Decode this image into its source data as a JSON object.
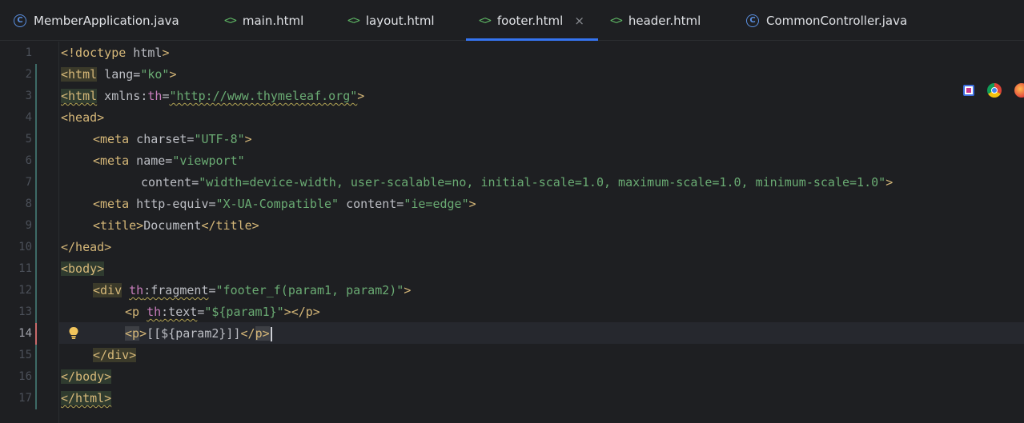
{
  "tabs": [
    {
      "label": "MemberApplication.java",
      "icon": "java-class-icon"
    },
    {
      "label": "main.html",
      "icon": "html-file-icon"
    },
    {
      "label": "layout.html",
      "icon": "html-file-icon"
    },
    {
      "label": "footer.html",
      "icon": "html-file-icon",
      "active": true
    },
    {
      "label": "header.html",
      "icon": "html-file-icon"
    },
    {
      "label": "CommonController.java",
      "icon": "java-class-icon"
    }
  ],
  "html_icon_glyph": "<>",
  "java_icon_glyph": "C",
  "close_glyph": "×",
  "current_line": 14,
  "line_numbers": [
    "1",
    "2",
    "3",
    "4",
    "5",
    "6",
    "7",
    "8",
    "9",
    "10",
    "11",
    "12",
    "13",
    "14",
    "15",
    "16",
    "17"
  ],
  "code": {
    "l1": {
      "a": "<!doctype",
      "b": " html",
      "c": ">"
    },
    "l2": {
      "a": "<html",
      "b": " lang=",
      "c": "\"ko\"",
      "d": ">"
    },
    "l3": {
      "a": "<html",
      "b": " xmlns:",
      "c": "th",
      "d": "=",
      "e": "\"http://www.thymeleaf.org\"",
      "f": ">"
    },
    "l4": {
      "a": "<head>"
    },
    "l5": {
      "a": "<meta",
      "b": " charset=",
      "c": "\"UTF-8\"",
      "d": ">"
    },
    "l6": {
      "a": "<meta",
      "b": " name=",
      "c": "\"viewport\""
    },
    "l7": {
      "a": "content=",
      "b": "\"width=device-width, user-scalable=no, initial-scale=1.0, maximum-scale=1.0, minimum-scale=1.0\"",
      "c": ">"
    },
    "l8": {
      "a": "<meta",
      "b": " http-equiv=",
      "c": "\"X-UA-Compatible\"",
      "d": " content=",
      "e": "\"ie=edge\"",
      "f": ">"
    },
    "l9": {
      "a": "<title>",
      "b": "Document",
      "c": "</title>"
    },
    "l10": {
      "a": "</head>"
    },
    "l11": {
      "a": "<body>"
    },
    "l12": {
      "a": "<div",
      "b": " ",
      "c": "th",
      "d": ":fragment",
      "e": "=",
      "f": "\"footer_f(param1, param2)\"",
      "g": ">"
    },
    "l13": {
      "a": "<p",
      "b": " ",
      "c": "th",
      "d": ":text",
      "e": "=",
      "f": "\"${param1}\"",
      "g": "></p>"
    },
    "l14": {
      "a": "<",
      "b": "p",
      "c": ">",
      "d": "[[${param2}]]",
      "e": "</",
      "f": "p",
      "g": ">"
    },
    "l15": {
      "a": "</div>"
    },
    "l16": {
      "a": "</body>"
    },
    "l17": {
      "a": "</html>"
    }
  },
  "colors": {
    "tag": "#d5b778",
    "string": "#6aab73",
    "namespace": "#c77dbb",
    "text": "#bcbec4",
    "active_tab_underline": "#3574f0"
  },
  "floating_toolbar": [
    "intellij-browser-icon",
    "chrome-icon",
    "firefox-icon"
  ]
}
